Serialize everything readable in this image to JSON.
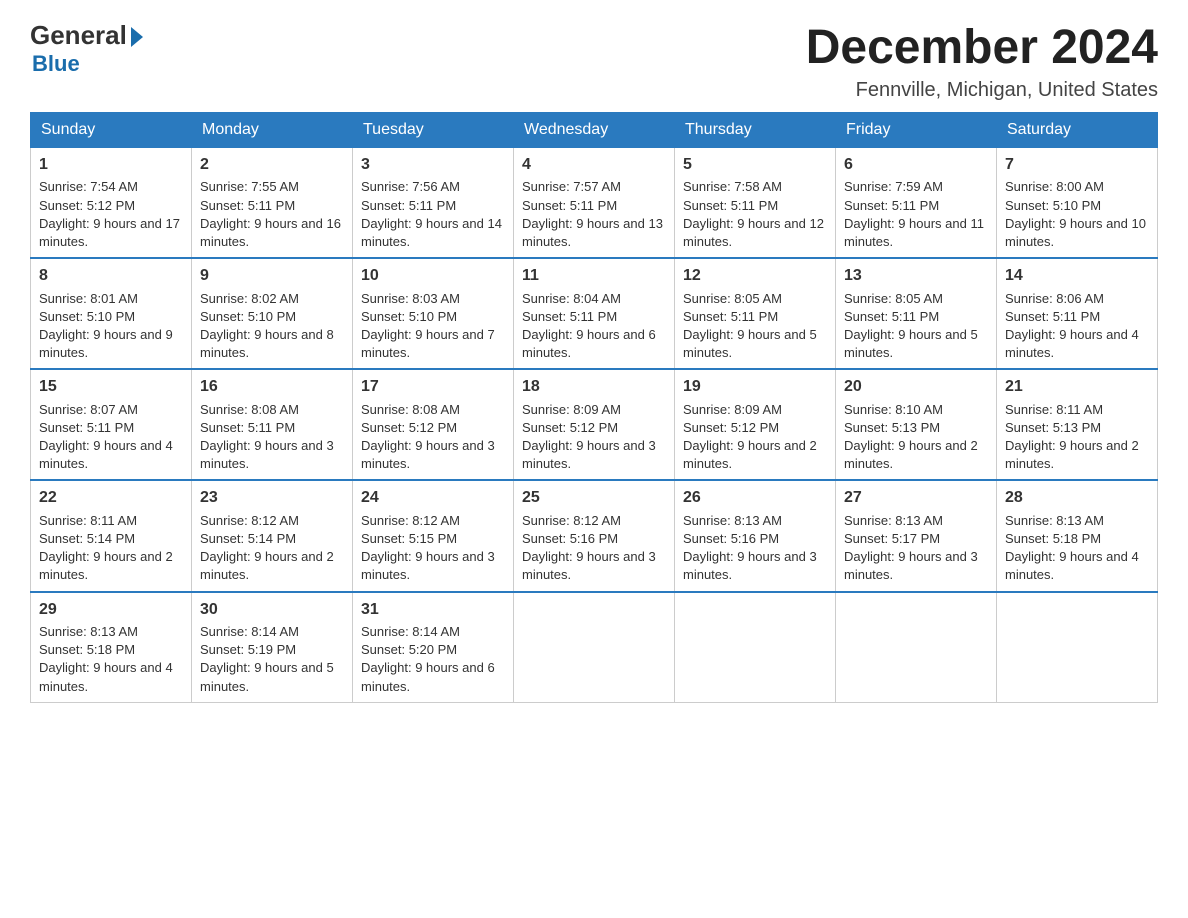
{
  "header": {
    "logo_general": "General",
    "logo_blue": "Blue",
    "title": "December 2024",
    "subtitle": "Fennville, Michigan, United States"
  },
  "days_of_week": [
    "Sunday",
    "Monday",
    "Tuesday",
    "Wednesday",
    "Thursday",
    "Friday",
    "Saturday"
  ],
  "weeks": [
    [
      {
        "num": "1",
        "sunrise": "7:54 AM",
        "sunset": "5:12 PM",
        "daylight": "9 hours and 17 minutes."
      },
      {
        "num": "2",
        "sunrise": "7:55 AM",
        "sunset": "5:11 PM",
        "daylight": "9 hours and 16 minutes."
      },
      {
        "num": "3",
        "sunrise": "7:56 AM",
        "sunset": "5:11 PM",
        "daylight": "9 hours and 14 minutes."
      },
      {
        "num": "4",
        "sunrise": "7:57 AM",
        "sunset": "5:11 PM",
        "daylight": "9 hours and 13 minutes."
      },
      {
        "num": "5",
        "sunrise": "7:58 AM",
        "sunset": "5:11 PM",
        "daylight": "9 hours and 12 minutes."
      },
      {
        "num": "6",
        "sunrise": "7:59 AM",
        "sunset": "5:11 PM",
        "daylight": "9 hours and 11 minutes."
      },
      {
        "num": "7",
        "sunrise": "8:00 AM",
        "sunset": "5:10 PM",
        "daylight": "9 hours and 10 minutes."
      }
    ],
    [
      {
        "num": "8",
        "sunrise": "8:01 AM",
        "sunset": "5:10 PM",
        "daylight": "9 hours and 9 minutes."
      },
      {
        "num": "9",
        "sunrise": "8:02 AM",
        "sunset": "5:10 PM",
        "daylight": "9 hours and 8 minutes."
      },
      {
        "num": "10",
        "sunrise": "8:03 AM",
        "sunset": "5:10 PM",
        "daylight": "9 hours and 7 minutes."
      },
      {
        "num": "11",
        "sunrise": "8:04 AM",
        "sunset": "5:11 PM",
        "daylight": "9 hours and 6 minutes."
      },
      {
        "num": "12",
        "sunrise": "8:05 AM",
        "sunset": "5:11 PM",
        "daylight": "9 hours and 5 minutes."
      },
      {
        "num": "13",
        "sunrise": "8:05 AM",
        "sunset": "5:11 PM",
        "daylight": "9 hours and 5 minutes."
      },
      {
        "num": "14",
        "sunrise": "8:06 AM",
        "sunset": "5:11 PM",
        "daylight": "9 hours and 4 minutes."
      }
    ],
    [
      {
        "num": "15",
        "sunrise": "8:07 AM",
        "sunset": "5:11 PM",
        "daylight": "9 hours and 4 minutes."
      },
      {
        "num": "16",
        "sunrise": "8:08 AM",
        "sunset": "5:11 PM",
        "daylight": "9 hours and 3 minutes."
      },
      {
        "num": "17",
        "sunrise": "8:08 AM",
        "sunset": "5:12 PM",
        "daylight": "9 hours and 3 minutes."
      },
      {
        "num": "18",
        "sunrise": "8:09 AM",
        "sunset": "5:12 PM",
        "daylight": "9 hours and 3 minutes."
      },
      {
        "num": "19",
        "sunrise": "8:09 AM",
        "sunset": "5:12 PM",
        "daylight": "9 hours and 2 minutes."
      },
      {
        "num": "20",
        "sunrise": "8:10 AM",
        "sunset": "5:13 PM",
        "daylight": "9 hours and 2 minutes."
      },
      {
        "num": "21",
        "sunrise": "8:11 AM",
        "sunset": "5:13 PM",
        "daylight": "9 hours and 2 minutes."
      }
    ],
    [
      {
        "num": "22",
        "sunrise": "8:11 AM",
        "sunset": "5:14 PM",
        "daylight": "9 hours and 2 minutes."
      },
      {
        "num": "23",
        "sunrise": "8:12 AM",
        "sunset": "5:14 PM",
        "daylight": "9 hours and 2 minutes."
      },
      {
        "num": "24",
        "sunrise": "8:12 AM",
        "sunset": "5:15 PM",
        "daylight": "9 hours and 3 minutes."
      },
      {
        "num": "25",
        "sunrise": "8:12 AM",
        "sunset": "5:16 PM",
        "daylight": "9 hours and 3 minutes."
      },
      {
        "num": "26",
        "sunrise": "8:13 AM",
        "sunset": "5:16 PM",
        "daylight": "9 hours and 3 minutes."
      },
      {
        "num": "27",
        "sunrise": "8:13 AM",
        "sunset": "5:17 PM",
        "daylight": "9 hours and 3 minutes."
      },
      {
        "num": "28",
        "sunrise": "8:13 AM",
        "sunset": "5:18 PM",
        "daylight": "9 hours and 4 minutes."
      }
    ],
    [
      {
        "num": "29",
        "sunrise": "8:13 AM",
        "sunset": "5:18 PM",
        "daylight": "9 hours and 4 minutes."
      },
      {
        "num": "30",
        "sunrise": "8:14 AM",
        "sunset": "5:19 PM",
        "daylight": "9 hours and 5 minutes."
      },
      {
        "num": "31",
        "sunrise": "8:14 AM",
        "sunset": "5:20 PM",
        "daylight": "9 hours and 6 minutes."
      },
      null,
      null,
      null,
      null
    ]
  ],
  "labels": {
    "sunrise_prefix": "Sunrise: ",
    "sunset_prefix": "Sunset: ",
    "daylight_prefix": "Daylight: "
  }
}
